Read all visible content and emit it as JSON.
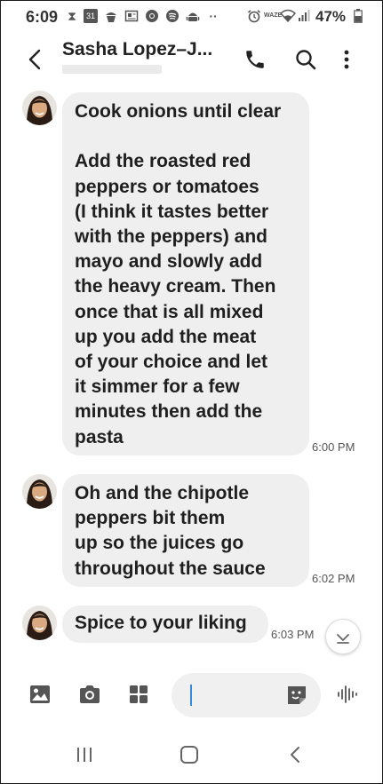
{
  "status_bar": {
    "time": "6:09",
    "battery": "47%",
    "icons": [
      "hourglass-icon",
      "calendar-icon",
      "cupcake-icon",
      "news-icon",
      "chrome-icon",
      "spotify-icon",
      "android-icon",
      "more-dots-icon",
      "alarm-icon",
      "waze-icon",
      "wifi-icon",
      "signal-icon",
      "battery-icon"
    ],
    "calendar_day": "31"
  },
  "header": {
    "contact_name": "Sasha Lopez–J...",
    "icons": [
      "back-arrow-icon",
      "phone-icon",
      "search-icon",
      "more-vert-icon"
    ]
  },
  "messages": [
    {
      "text": "Cook onions until clear\n\nAdd the roasted red\npeppers or tomatoes\n(I think it tastes better\nwith the peppers) and\nmayo and slowly add\nthe heavy cream. Then\nonce that is all mixed\nup you add the meat\nof your choice and let\nit simmer for a few\nminutes then add the\npasta",
      "time": "6:00 PM"
    },
    {
      "text": "Oh and the chipotle\npeppers bit them\nup so the juices go\nthroughout the sauce",
      "time": "6:02 PM"
    },
    {
      "text": "Spice to your liking",
      "time": "6:03 PM"
    }
  ],
  "composer": {
    "icons": [
      "image-icon",
      "camera-icon",
      "apps-grid-icon",
      "sticker-icon",
      "voice-icon"
    ],
    "input_value": ""
  },
  "navbar": {
    "icons": [
      "recents-icon",
      "home-icon",
      "nav-back-icon"
    ]
  },
  "colors": {
    "bubble_bg": "#efefef",
    "cursor": "#3b8ad9"
  }
}
